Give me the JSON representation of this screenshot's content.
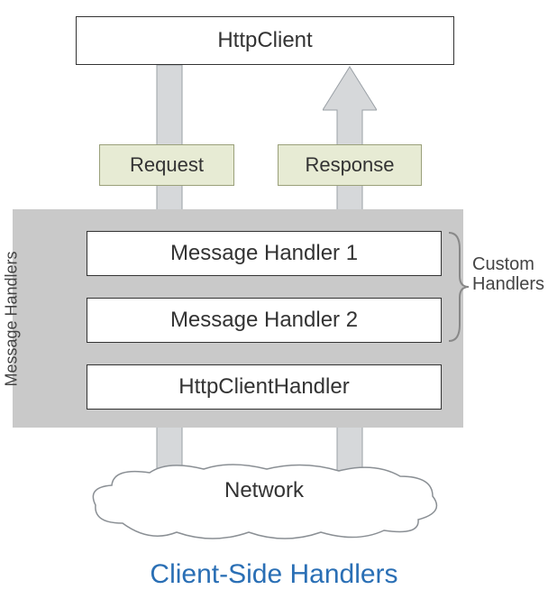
{
  "top_box": "HttpClient",
  "request_label": "Request",
  "response_label": "Response",
  "panel_label": "Message Handlers",
  "handlers": {
    "h1": "Message Handler 1",
    "h2": "Message Handler 2",
    "h3": "HttpClientHandler"
  },
  "custom_label_line1": "Custom",
  "custom_label_line2": "Handlers",
  "cloud_label": "Network",
  "title": "Client-Side Handlers",
  "colors": {
    "arrow_fill": "#d6d8da",
    "arrow_stroke": "#9aa0a6",
    "tag_bg": "#e7ebd4",
    "panel_bg": "#c9c9c9",
    "title_color": "#2a6fb5"
  },
  "chart_data": {
    "type": "flow-diagram",
    "nodes": [
      {
        "id": "httpclient",
        "label": "HttpClient"
      },
      {
        "id": "request",
        "label": "Request",
        "kind": "tag"
      },
      {
        "id": "response",
        "label": "Response",
        "kind": "tag"
      },
      {
        "id": "mh1",
        "label": "Message Handler 1",
        "group": "Message Handlers",
        "custom": true
      },
      {
        "id": "mh2",
        "label": "Message Handler 2",
        "group": "Message Handlers",
        "custom": true
      },
      {
        "id": "hch",
        "label": "HttpClientHandler",
        "group": "Message Handlers"
      },
      {
        "id": "network",
        "label": "Network",
        "kind": "cloud"
      }
    ],
    "edges": [
      {
        "from": "httpclient",
        "to": "network",
        "via": [
          "request",
          "mh1",
          "mh2",
          "hch"
        ],
        "label": "Request",
        "direction": "down"
      },
      {
        "from": "network",
        "to": "httpclient",
        "via": [
          "hch",
          "mh2",
          "mh1",
          "response"
        ],
        "label": "Response",
        "direction": "up"
      }
    ],
    "annotations": [
      {
        "label": "Custom Handlers",
        "targets": [
          "mh1",
          "mh2"
        ]
      }
    ],
    "title": "Client-Side Handlers"
  }
}
